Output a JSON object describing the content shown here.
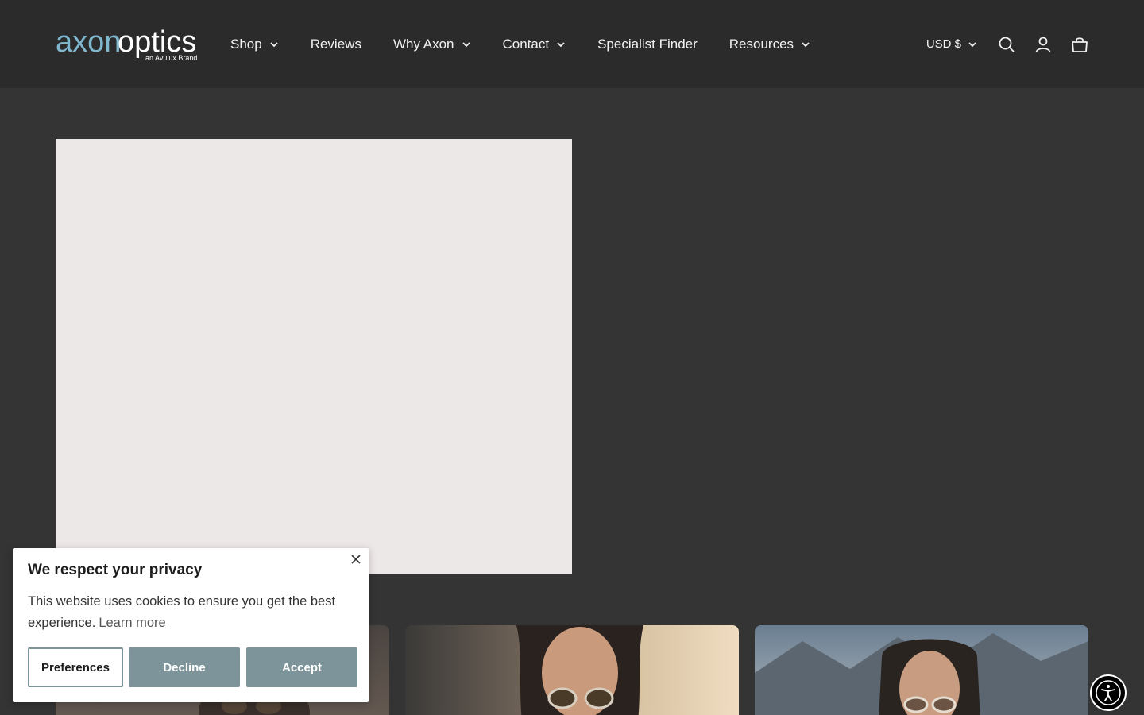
{
  "brand": {
    "logo_text_primary": "axon",
    "logo_text_secondary": "optics",
    "logo_tagline": "an Avulux Brand",
    "colors": {
      "axon": "#7fb8cf",
      "optics": "#ffffff"
    }
  },
  "nav": {
    "items": [
      {
        "label": "Shop",
        "has_dropdown": true
      },
      {
        "label": "Reviews",
        "has_dropdown": false
      },
      {
        "label": "Why Axon",
        "has_dropdown": true
      },
      {
        "label": "Contact",
        "has_dropdown": true
      },
      {
        "label": "Specialist Finder",
        "has_dropdown": false
      },
      {
        "label": "Resources",
        "has_dropdown": true
      }
    ]
  },
  "tools": {
    "currency": "USD $",
    "icons": [
      "search-icon",
      "account-icon",
      "cart-icon"
    ]
  },
  "cookie_banner": {
    "title": "We respect your privacy",
    "text": "This website uses cookies to ensure you get the best experience.",
    "learn_more": "Learn more",
    "preferences": "Preferences",
    "decline": "Decline",
    "accept": "Accept",
    "accent_color": "#7d949a"
  },
  "accessibility": {
    "icon": "accessibility-icon"
  }
}
